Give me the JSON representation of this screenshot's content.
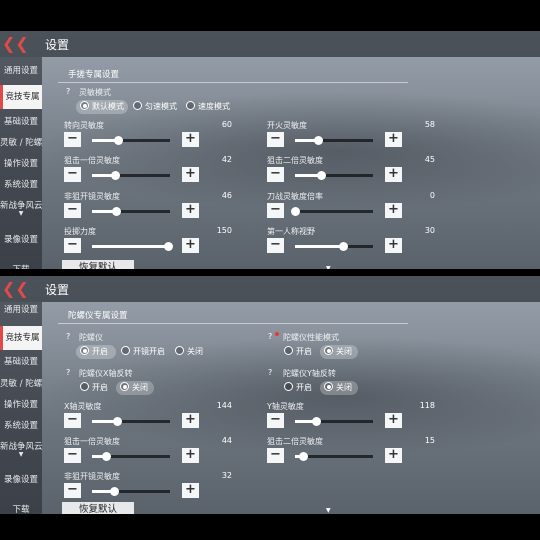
{
  "frames": [
    {
      "title": "设置",
      "sidebar": [
        {
          "label": "通用设置",
          "active": false
        },
        {
          "label": "竞技专属",
          "active": true
        },
        {
          "label": "基础设置",
          "active": false
        },
        {
          "label": "灵敏 / 陀螺",
          "active": false
        },
        {
          "label": "操作设置",
          "active": false
        },
        {
          "label": "系统设置",
          "active": false
        },
        {
          "label": "新战争风云",
          "active": false
        },
        {
          "label": "录像设置",
          "active": false
        },
        {
          "label": "下载",
          "active": false
        }
      ],
      "section_title": "手搓专属设置",
      "mode": {
        "label": "灵敏模式",
        "options": [
          "默认模式",
          "匀速模式",
          "速度模式"
        ],
        "selected": 0
      },
      "sliders": [
        {
          "label": "转向灵敏度",
          "value": "60",
          "fraction": 0.33
        },
        {
          "label": "开火灵敏度",
          "value": "58",
          "fraction": 0.29
        },
        {
          "label": "狙击一倍灵敏度",
          "value": "42",
          "fraction": 0.29
        },
        {
          "label": "狙击二倍灵敏度",
          "value": "45",
          "fraction": 0.33
        },
        {
          "label": "非狙开镜灵敏度",
          "value": "46",
          "fraction": 0.31
        },
        {
          "label": "刀战灵敏度倍率",
          "value": "0",
          "fraction": 0.0
        },
        {
          "label": "投掷力度",
          "value": "150",
          "fraction": 0.98
        },
        {
          "label": "第一人称视野",
          "value": "30",
          "fraction": 0.62
        }
      ],
      "reset_label": "恢复默认"
    },
    {
      "title": "设置",
      "sidebar": [
        {
          "label": "通用设置",
          "active": false
        },
        {
          "label": "竞技专属",
          "active": true
        },
        {
          "label": "基础设置",
          "active": false
        },
        {
          "label": "灵敏 / 陀螺",
          "active": false
        },
        {
          "label": "操作设置",
          "active": false
        },
        {
          "label": "系统设置",
          "active": false
        },
        {
          "label": "新战争风云",
          "active": false
        },
        {
          "label": "录像设置",
          "active": false
        },
        {
          "label": "下载",
          "active": false
        }
      ],
      "section_title": "陀螺仪专属设置",
      "groups": [
        {
          "label": "陀螺仪",
          "options": [
            "开启",
            "开镜开启",
            "关闭"
          ],
          "selected": 0
        },
        {
          "label": "陀螺仪性能模式",
          "options": [
            "开启",
            "关闭"
          ],
          "selected": 1
        },
        {
          "label": "陀螺仪X轴反转",
          "options": [
            "开启",
            "关闭"
          ],
          "selected": 1
        },
        {
          "label": "陀螺仪Y轴反转",
          "options": [
            "开启",
            "关闭"
          ],
          "selected": 1
        }
      ],
      "sliders": [
        {
          "label": "X轴灵敏度",
          "value": "144",
          "fraction": 0.32
        },
        {
          "label": "Y轴灵敏度",
          "value": "118",
          "fraction": 0.27
        },
        {
          "label": "狙击一倍灵敏度",
          "value": "44",
          "fraction": 0.18
        },
        {
          "label": "狙击二倍灵敏度",
          "value": "15",
          "fraction": 0.1
        },
        {
          "label": "非狙开镜灵敏度",
          "value": "32",
          "fraction": 0.28
        }
      ],
      "reset_label": "恢复默认"
    }
  ]
}
